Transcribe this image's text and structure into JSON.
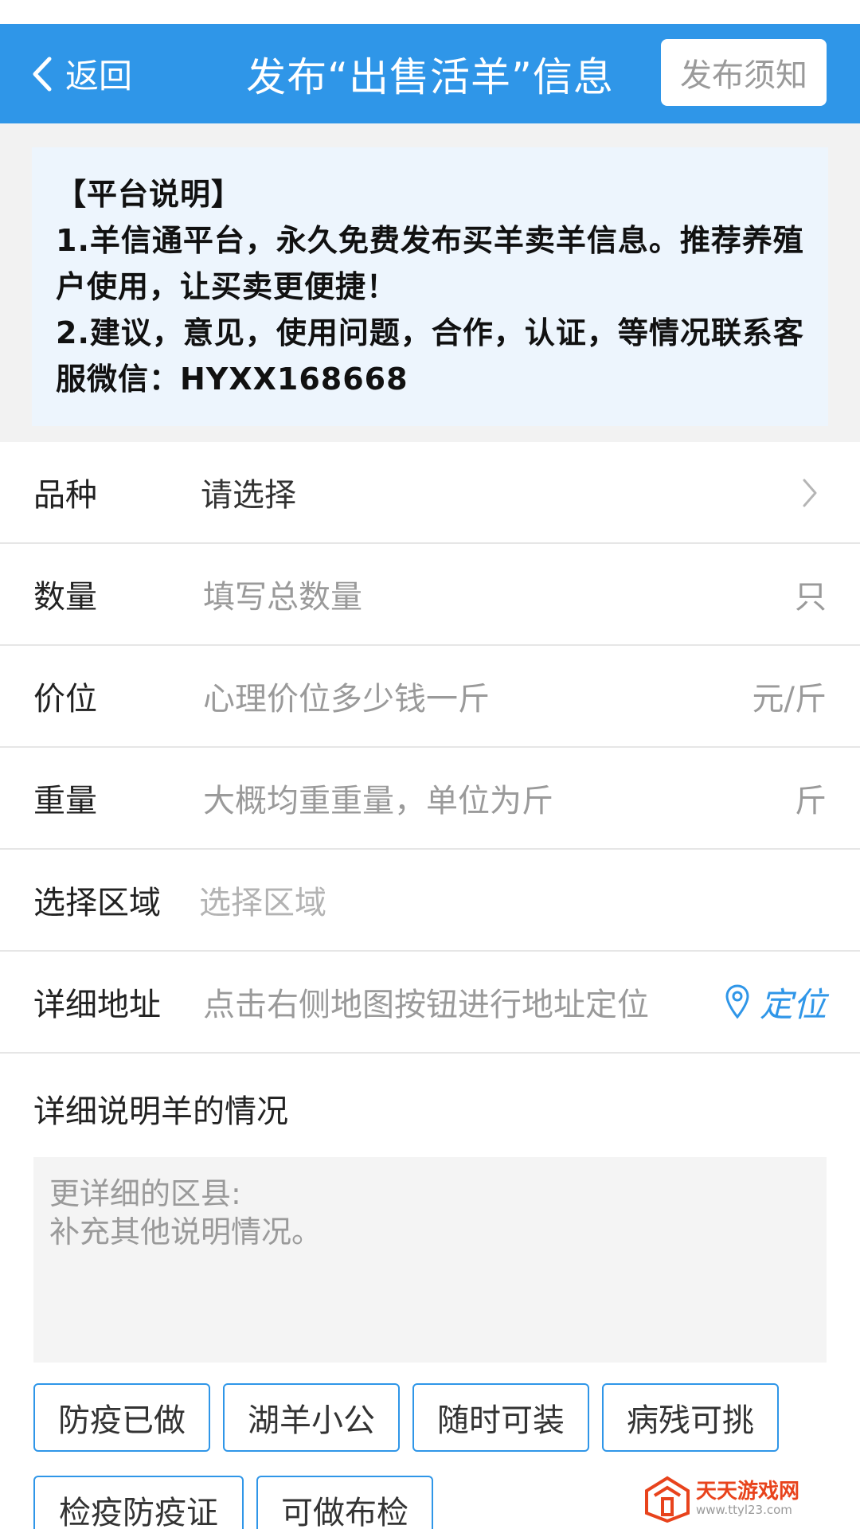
{
  "header": {
    "back_label": "返回",
    "title": "发布“出售活羊”信息",
    "notice_button": "发布须知"
  },
  "platform_notice": {
    "heading": "【平台说明】",
    "line1": "1.羊信通平台，永久免费发布买羊卖羊信息。推荐养殖户使用，让买卖更便捷！",
    "line2": "2.建议，意见，使用问题，合作，认证，等情况联系客服微信：HYXX168668"
  },
  "form": {
    "breed": {
      "label": "品种",
      "value": "请选择"
    },
    "quantity": {
      "label": "数量",
      "placeholder": "填写总数量",
      "unit": "只"
    },
    "price": {
      "label": "价位",
      "placeholder": "心理价位多少钱一斤",
      "unit": "元/斤"
    },
    "weight": {
      "label": "重量",
      "placeholder": "大概均重重量，单位为斤",
      "unit": "斤"
    },
    "region": {
      "label": "选择区域",
      "placeholder": "选择区域"
    },
    "address": {
      "label": "详细地址",
      "placeholder": "点击右侧地图按钮进行地址定位",
      "locate_label": "定位"
    }
  },
  "description": {
    "title": "详细说明羊的情况",
    "placeholder": "更详细的区县:\n补充其他说明情况。"
  },
  "tags": [
    "防疫已做",
    "湖羊小公",
    "随时可装",
    "病残可挑",
    "检疫防疫证",
    "可做布检"
  ],
  "watermark": {
    "name": "天天游戏网",
    "url": "www.ttyl23.com"
  },
  "colors": {
    "primary": "#2f96e8",
    "watermark": "#e8431c"
  }
}
